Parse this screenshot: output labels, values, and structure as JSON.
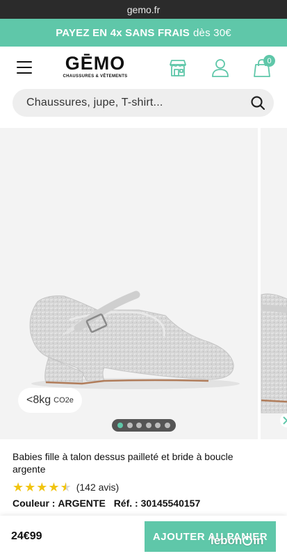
{
  "browser": {
    "url": "gemo.fr"
  },
  "promo": {
    "main": "PAYEZ EN 4x SANS FRAIS",
    "small": "dès 30€"
  },
  "header": {
    "logo": "GĒMO",
    "logo_tagline": "CHAUSSURES & VÊTEMENTS",
    "icons": [
      "menu-icon",
      "store-icon",
      "account-icon",
      "cart-icon"
    ],
    "cart_count": "0"
  },
  "search": {
    "placeholder": "Chaussures, jupe, T-shirt..."
  },
  "gallery": {
    "co2_value": "<8kg",
    "co2_unit": "CO2e",
    "slide_count": 6,
    "active_slide": 1
  },
  "product": {
    "title": "Babies fille à talon dessus pailleté et bride à boucle argente",
    "rating": 4.5,
    "reviews": "(142 avis)",
    "color_label": "Couleur :",
    "color_value": "ARGENTE",
    "ref_label": "Réf. :",
    "ref_value": "30145540157"
  },
  "bottom": {
    "price": "24€99",
    "add_to_cart": "AJOUTER AU PANIER"
  },
  "watermark": {
    "text_before": "lebon",
    "text_after": "in"
  },
  "colors": {
    "accent": "#5fc7a9",
    "star": "#f1c40f",
    "url_bar": "#2b2b2b"
  }
}
